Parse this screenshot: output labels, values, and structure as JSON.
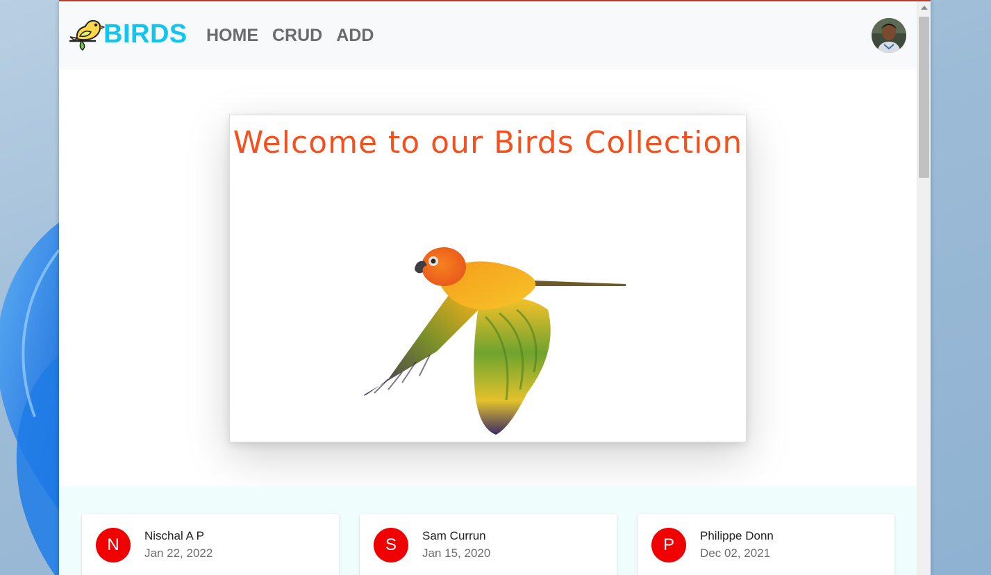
{
  "navbar": {
    "brand_name": "BIRDS",
    "links": [
      "HOME",
      "CRUD",
      "ADD"
    ]
  },
  "hero": {
    "title": "Welcome to our Birds Collection"
  },
  "posts": [
    {
      "initial": "N",
      "name": "Nischal A P",
      "date": "Jan 22, 2022"
    },
    {
      "initial": "S",
      "name": "Sam Currun",
      "date": "Jan 15, 2020"
    },
    {
      "initial": "P",
      "name": "Philippe Donn",
      "date": "Dec 02, 2021"
    }
  ],
  "colors": {
    "brand": "#11c5ee",
    "title": "#f4511e",
    "avatar_bg": "#f00000",
    "posts_bg": "#effdfd"
  },
  "icons": [
    "bird-logo-icon",
    "user-avatar",
    "parrot-image",
    "scroll-up-icon"
  ]
}
